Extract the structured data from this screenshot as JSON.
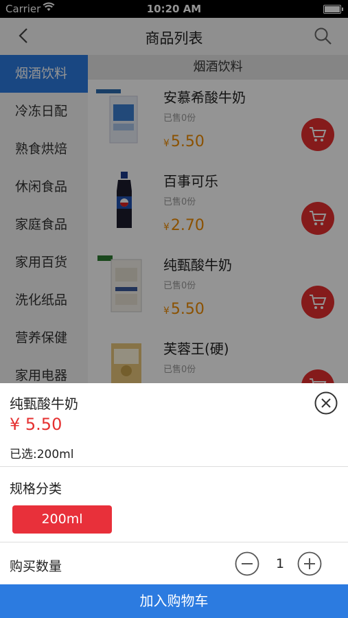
{
  "status_bar": {
    "carrier": "Carrier",
    "time": "10:20 AM"
  },
  "navbar": {
    "title": "商品列表",
    "back_icon": "chevron-left-icon",
    "search_icon": "search-icon"
  },
  "sidebar": {
    "items": [
      {
        "label": "烟酒饮料",
        "active": true
      },
      {
        "label": "冷冻日配"
      },
      {
        "label": "熟食烘焙"
      },
      {
        "label": "休闲食品"
      },
      {
        "label": "家庭食品"
      },
      {
        "label": "家用百货"
      },
      {
        "label": "洗化纸品"
      },
      {
        "label": "营养保健"
      },
      {
        "label": "家用电器"
      }
    ]
  },
  "content": {
    "category_header": "烟酒饮料",
    "products": [
      {
        "name": "安慕希酸牛奶",
        "sold": "已售0份",
        "currency": "¥",
        "price": "5.50"
      },
      {
        "name": "百事可乐",
        "sold": "已售0份",
        "currency": "¥",
        "price": "2.70"
      },
      {
        "name": "纯甄酸牛奶",
        "sold": "已售0份",
        "currency": "¥",
        "price": "5.50"
      },
      {
        "name": "芙蓉王(硬)",
        "sold": "已售0份",
        "currency": "¥",
        "price": ""
      }
    ]
  },
  "sheet": {
    "product_name": "纯甄酸牛奶",
    "price": "¥ 5.50",
    "selected": "已选:200ml",
    "spec_title": "规格分类",
    "spec_option": "200ml",
    "quantity_label": "购买数量",
    "quantity": "1"
  },
  "add_to_cart": "加入购物车",
  "colors": {
    "accent_blue": "#2c7be0",
    "price_red": "#e53030",
    "price_orange": "#f08c00",
    "spec_red": "#e8303a"
  }
}
